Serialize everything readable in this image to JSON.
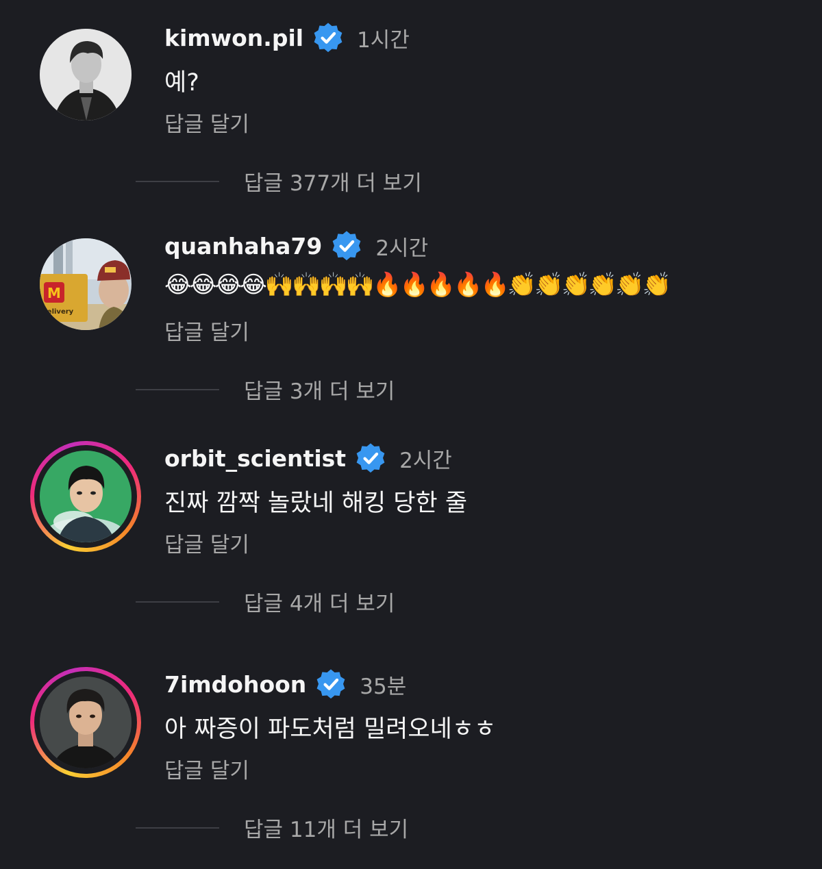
{
  "colors": {
    "background": "#1c1d22",
    "verified": "#3897f0",
    "secondary_text": "#a8a8a8"
  },
  "comments": [
    {
      "username": "kimwon.pil",
      "time": "1시간",
      "text": "예?",
      "reply_label": "답글 달기",
      "more_replies": "답글 377개 더 보기",
      "avatar_icon": "avatar-photo-grayscale",
      "story_ring": false
    },
    {
      "username": "quanhaha79",
      "time": "2시간",
      "text": "😂😂😂😂🙌🙌🙌🙌🔥🔥🔥🔥🔥👏👏👏👏👏👏",
      "reply_label": "답글 달기",
      "more_replies": "답글 3개 더 보기",
      "avatar_icon": "avatar-photo-delivery",
      "story_ring": false
    },
    {
      "username": "orbit_scientist",
      "time": "2시간",
      "text": "진짜 깜짝 놀랐네 해킹 당한 줄",
      "reply_label": "답글 달기",
      "more_replies": "답글 4개 더 보기",
      "avatar_icon": "avatar-photo-green",
      "story_ring": true
    },
    {
      "username": "7imdohoon",
      "time": "35분",
      "text": "아 짜증이 파도처럼 밀려오네ㅎㅎ",
      "reply_label": "답글 달기",
      "more_replies": "답글 11개 더 보기",
      "avatar_icon": "avatar-photo-portrait",
      "story_ring": true
    }
  ]
}
